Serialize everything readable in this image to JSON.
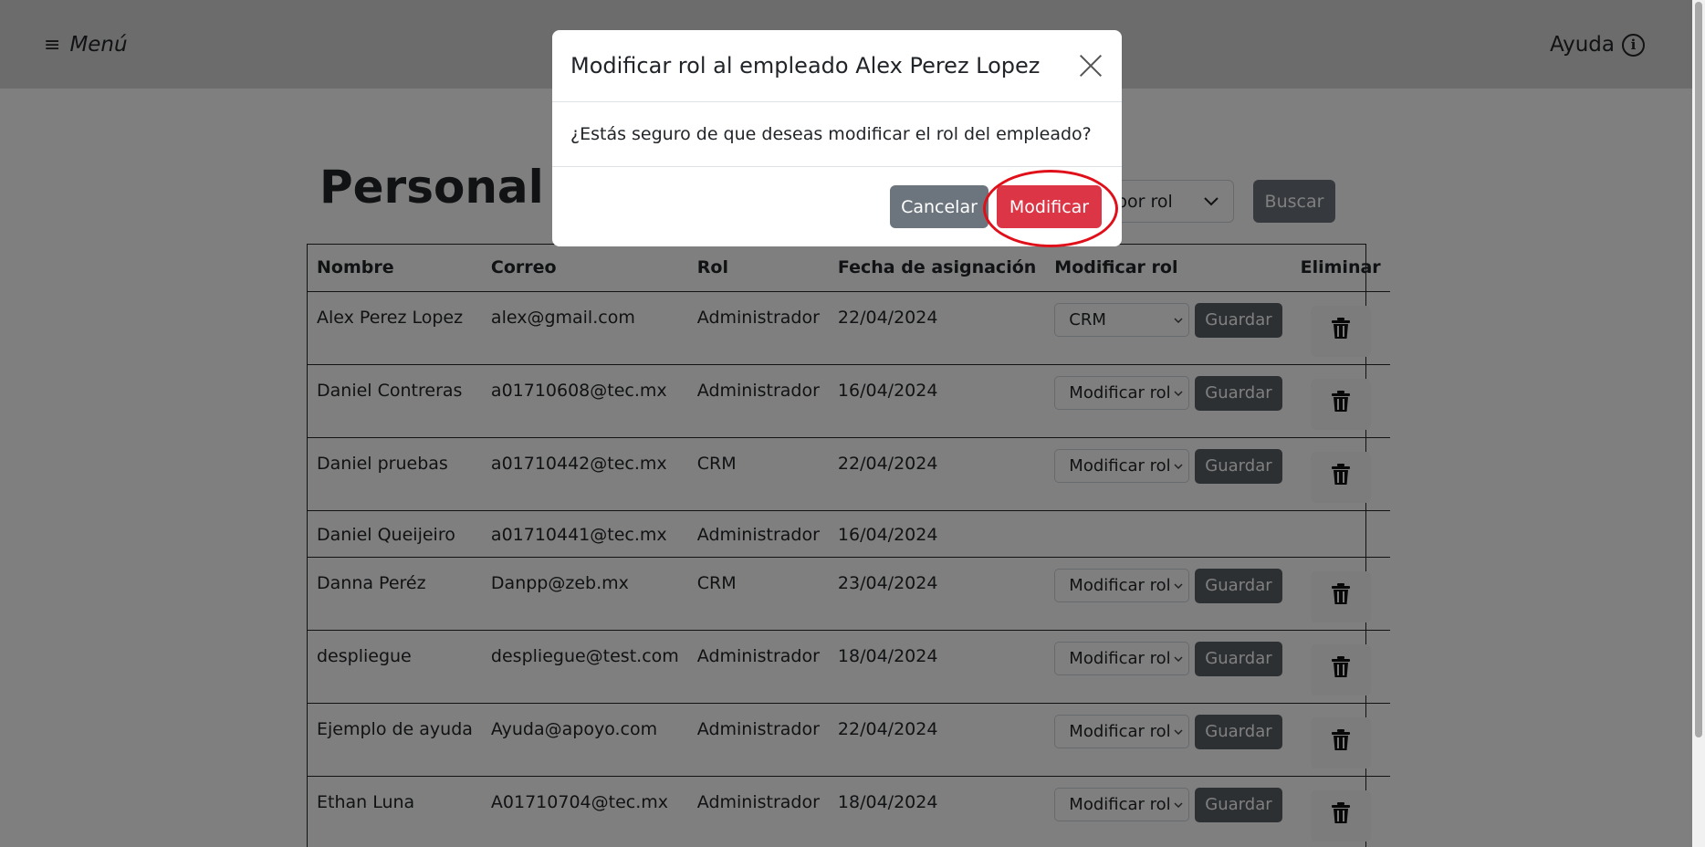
{
  "navbar": {
    "menu_icon": "≡",
    "menu_label": "Menú",
    "help_label": "Ayuda",
    "help_icon": "i"
  },
  "page": {
    "title": "Personal",
    "role_filter_placeholder": "por rol",
    "search_label": "Buscar"
  },
  "table": {
    "headers": [
      "Nombre",
      "Correo",
      "Rol",
      "Fecha de asignación",
      "Modificar rol",
      "Eliminar"
    ],
    "rows": [
      {
        "nombre": "Alex Perez Lopez",
        "correo": "alex@gmail.com",
        "rol": "Administrador",
        "fecha": "22/04/2024",
        "select_value": "CRM",
        "save_label": "Guardar"
      },
      {
        "nombre": "Daniel Contreras",
        "correo": "a01710608@tec.mx",
        "rol": "Administrador",
        "fecha": "16/04/2024",
        "select_value": "Modificar rol",
        "save_label": "Guardar"
      },
      {
        "nombre": "Daniel pruebas",
        "correo": "a01710442@tec.mx",
        "rol": "CRM",
        "fecha": "22/04/2024",
        "select_value": "Modificar rol",
        "save_label": "Guardar"
      },
      {
        "nombre": "Daniel Queijeiro",
        "correo": "a01710441@tec.mx",
        "rol": "Administrador",
        "fecha": "16/04/2024"
      },
      {
        "nombre": "Danna Peréz",
        "correo": "Danpp@zeb.mx",
        "rol": "CRM",
        "fecha": "23/04/2024",
        "select_value": "Modificar rol",
        "save_label": "Guardar"
      },
      {
        "nombre": "despliegue",
        "correo": "despliegue@test.com",
        "rol": "Administrador",
        "fecha": "18/04/2024",
        "select_value": "Modificar rol",
        "save_label": "Guardar"
      },
      {
        "nombre": "Ejemplo de ayuda",
        "correo": "Ayuda@apoyo.com",
        "rol": "Administrador",
        "fecha": "22/04/2024",
        "select_value": "Modificar rol",
        "save_label": "Guardar"
      },
      {
        "nombre": "Ethan Luna",
        "correo": "A01710704@tec.mx",
        "rol": "Administrador",
        "fecha": "18/04/2024",
        "select_value": "Modificar rol",
        "save_label": "Guardar"
      }
    ]
  },
  "modal": {
    "title": "Modificar rol al empleado Alex Perez Lopez",
    "body": "¿Estás seguro de que deseas modificar el rol del empleado?",
    "cancel_label": "Cancelar",
    "confirm_label": "Modificar"
  },
  "colors": {
    "confirm": "#dc3545",
    "secondary": "#6c757d",
    "highlight": "#e0101a"
  }
}
